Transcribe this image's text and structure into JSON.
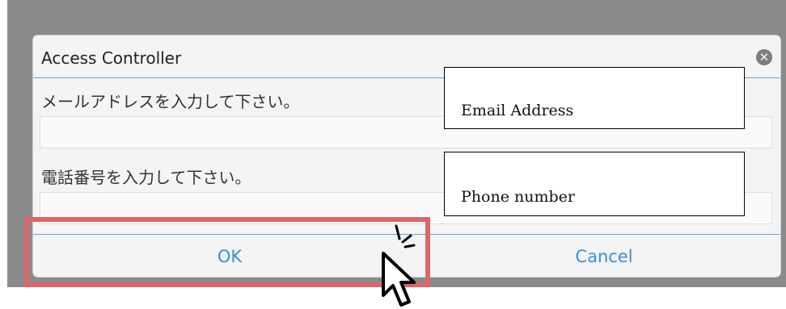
{
  "dialog": {
    "title": "Access Controller",
    "close_icon": "close-circle-icon",
    "fields": [
      {
        "label": "メールアドレスを入力して下さい。",
        "value": ""
      },
      {
        "label": "電話番号を入力して下さい。",
        "value": ""
      }
    ],
    "buttons": {
      "ok": "OK",
      "cancel": "Cancel"
    }
  },
  "annotations": {
    "email": "Email Address",
    "phone": "Phone number",
    "cursor_icon": "click-pointer-icon"
  },
  "colors": {
    "accent": "#5aa9e6",
    "button_text": "#3c8fd6",
    "highlight": "#d9686b",
    "backdrop": "#8a8a8a"
  }
}
